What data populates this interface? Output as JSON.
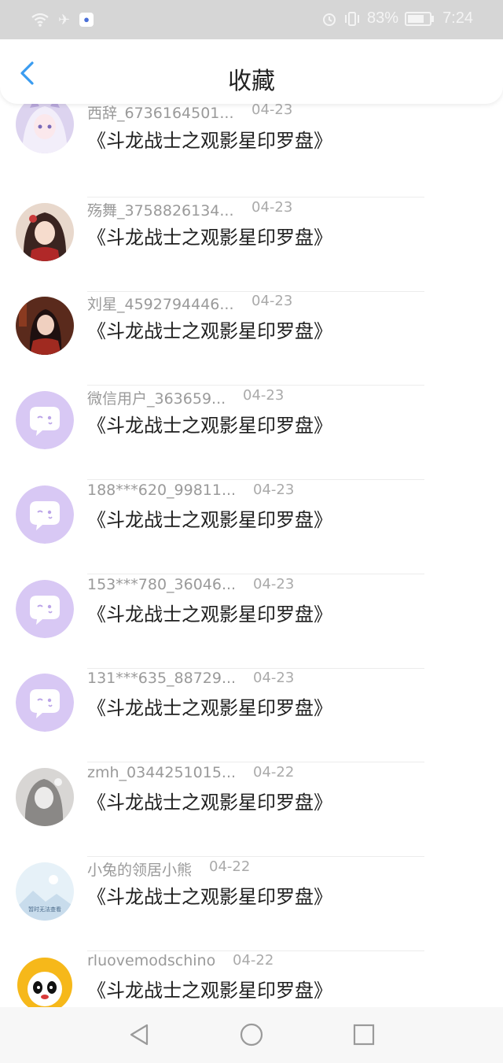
{
  "status_bar": {
    "battery_percent": "83%",
    "time": "7:24",
    "battery_level": 0.83,
    "left_icons": [
      "wifi-icon",
      "airplane-icon",
      "baidu-paw-icon"
    ],
    "right_icons": [
      "alarm-icon",
      "vibrate-icon",
      "battery-icon"
    ]
  },
  "header": {
    "title": "收藏",
    "back_icon": "chevron-left-icon",
    "accent": "#3a9cf0"
  },
  "items": [
    {
      "user": "西辞_6736164501...",
      "date": "04-23",
      "title": "《斗龙战士之观影星印罗盘》",
      "avatar": "anime-girl-white-hair"
    },
    {
      "user": "殇舞_3758826134...",
      "date": "04-23",
      "title": "《斗龙战士之观影星印罗盘》",
      "avatar": "anime-girl-red"
    },
    {
      "user": "刘星_4592794446...",
      "date": "04-23",
      "title": "《斗龙战士之观影星印罗盘》",
      "avatar": "anime-woman-dark"
    },
    {
      "user": "微信用户_363659...",
      "date": "04-23",
      "title": "《斗龙战士之观影星印罗盘》",
      "avatar": "default-bubble"
    },
    {
      "user": "188***620_99811...",
      "date": "04-23",
      "title": "《斗龙战士之观影星印罗盘》",
      "avatar": "default-bubble"
    },
    {
      "user": "153***780_36046...",
      "date": "04-23",
      "title": "《斗龙战士之观影星印罗盘》",
      "avatar": "default-bubble"
    },
    {
      "user": "131***635_88729...",
      "date": "04-23",
      "title": "《斗龙战士之观影星印罗盘》",
      "avatar": "default-bubble"
    },
    {
      "user": "zmh_0344251015...",
      "date": "04-22",
      "title": "《斗龙战士之观影星印罗盘》",
      "avatar": "sketch-girl-gray"
    },
    {
      "user": "小兔的领居小熊",
      "date": "04-22",
      "title": "《斗龙战士之观影星印罗盘》",
      "avatar": "image-placeholder",
      "avatar_text": "暂时无法查看"
    },
    {
      "user": "rluovemodschino",
      "date": "04-22",
      "title": "《斗龙战士之观影星印罗盘》",
      "avatar": "panda-sun"
    }
  ],
  "nav_bar": {
    "icons": [
      "back-triangle-icon",
      "home-circle-icon",
      "recents-square-icon"
    ]
  },
  "colors": {
    "default_avatar": "#d8c8f4",
    "username": "#9a9a9a",
    "date": "#aaaaaa"
  }
}
